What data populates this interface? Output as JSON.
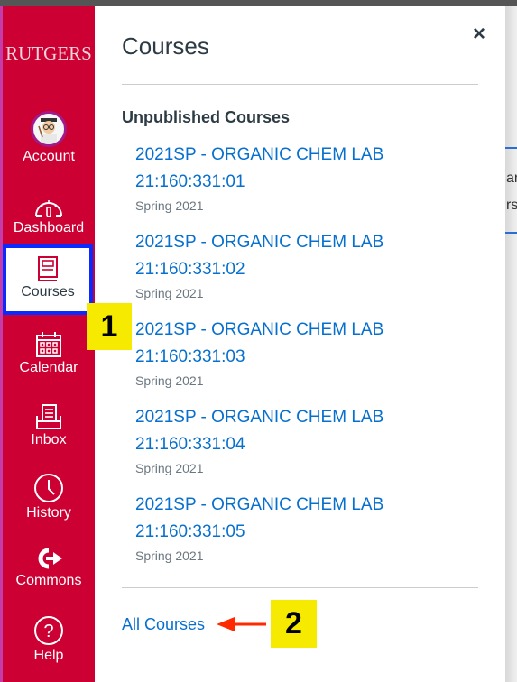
{
  "sidebar": {
    "logo_text": "RUTGERS",
    "items": [
      {
        "label": "Account",
        "icon": "avatar"
      },
      {
        "label": "Dashboard",
        "icon": "dashboard-gauge-icon"
      },
      {
        "label": "Courses",
        "icon": "book-icon",
        "active": true
      },
      {
        "label": "Calendar",
        "icon": "calendar-icon"
      },
      {
        "label": "Inbox",
        "icon": "inbox-icon"
      },
      {
        "label": "History",
        "icon": "clock-icon"
      },
      {
        "label": "Commons",
        "icon": "commons-arrow-icon"
      },
      {
        "label": "Help",
        "icon": "question-circle-icon"
      }
    ]
  },
  "tray": {
    "title": "Courses",
    "close_icon": "×",
    "section_heading": "Unpublished Courses",
    "courses": [
      {
        "name_line1": "2021SP - ORGANIC CHEM LAB",
        "name_line2": "21:160:331:01",
        "term": "Spring 2021"
      },
      {
        "name_line1": "2021SP - ORGANIC CHEM LAB",
        "name_line2": "21:160:331:02",
        "term": "Spring 2021"
      },
      {
        "name_line1": "2021SP - ORGANIC CHEM LAB",
        "name_line2": "21:160:331:03",
        "term": "Spring 2021"
      },
      {
        "name_line1": "2021SP - ORGANIC CHEM LAB",
        "name_line2": "21:160:331:04",
        "term": "Spring 2021"
      },
      {
        "name_line1": "2021SP - ORGANIC CHEM LAB",
        "name_line2": "21:160:331:05",
        "term": "Spring 2021"
      }
    ],
    "all_courses_label": "All Courses"
  },
  "annotations": {
    "badge1": "1",
    "badge2": "2"
  },
  "background": {
    "text_line1": "ar",
    "text_line2": "rs,"
  },
  "colors": {
    "sidebar_bg": "#cc0033",
    "link": "#0770cf",
    "highlight_border": "#0a2aff",
    "badge": "#f5ea00",
    "arrow": "#ff2a00"
  }
}
